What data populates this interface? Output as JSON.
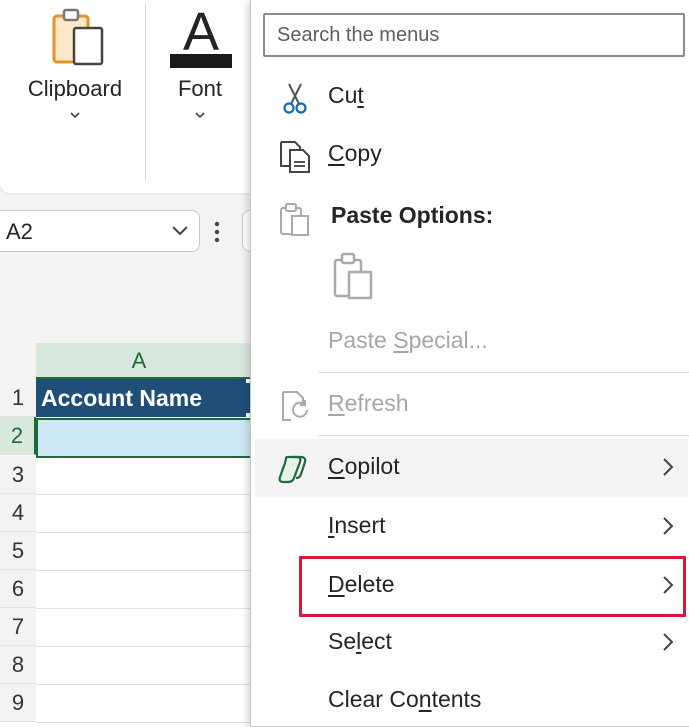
{
  "ribbon": {
    "groups": [
      {
        "label": "Clipboard",
        "icon": "clipboard-icon"
      },
      {
        "label": "Font",
        "icon": "font-icon",
        "glyph": "A"
      }
    ]
  },
  "name_box": {
    "value": "A2"
  },
  "grid": {
    "column_header": "A",
    "rows": [
      "1",
      "2",
      "3",
      "4",
      "5",
      "6",
      "7",
      "8",
      "9"
    ],
    "cell_a1": "Account Name"
  },
  "context_menu": {
    "search_placeholder": "Search the menus",
    "items": [
      {
        "pre": "Cu",
        "u": "t",
        "post": "",
        "icon": "scissors-icon",
        "enabled": true
      },
      {
        "pre": "",
        "u": "C",
        "post": "opy",
        "icon": "copy-icon",
        "enabled": true
      },
      {
        "label": "Paste Options:",
        "icon": "paste-icon",
        "enabled": true,
        "bold": true
      },
      {
        "pre": "Paste ",
        "u": "S",
        "post": "pecial...",
        "enabled": false
      },
      {
        "pre": "",
        "u": "R",
        "post": "efresh",
        "icon": "refresh-icon",
        "enabled": false
      },
      {
        "pre": "",
        "u": "C",
        "post": "opilot",
        "icon": "copilot-icon",
        "enabled": true,
        "submenu": true
      },
      {
        "pre": "",
        "u": "I",
        "post": "nsert",
        "enabled": true,
        "submenu": true
      },
      {
        "pre": "",
        "u": "D",
        "post": "elete",
        "enabled": true,
        "submenu": true,
        "highlighted": true
      },
      {
        "pre": "Se",
        "u": "l",
        "post": "ect",
        "enabled": true,
        "submenu": true
      },
      {
        "pre": "Clear Co",
        "u": "n",
        "post": "tents",
        "enabled": true
      }
    ]
  },
  "colors": {
    "highlight_border": "#d6183a",
    "header_fill": "#1f4e79",
    "selection_fill": "#cde8f5",
    "excel_green": "#1e6b3a"
  }
}
